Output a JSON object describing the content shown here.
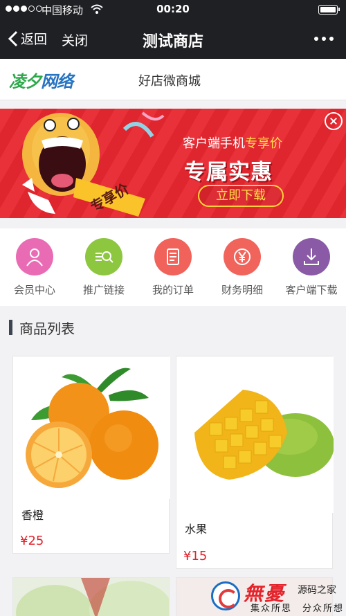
{
  "status_bar": {
    "carrier": "中国移动",
    "time": "00:20"
  },
  "nav": {
    "back_label": "返回",
    "close_label": "关闭",
    "title": "测试商店"
  },
  "brand": {
    "logo_part1": "凌夕",
    "logo_part2": "网络",
    "shop_title": "好店微商城"
  },
  "banner": {
    "mascot_tag": "专享价",
    "subtitle_prefix": "客户端手机",
    "subtitle_highlight": "专享价",
    "headline": "专属实惠",
    "download_label": "立即下载"
  },
  "shortcuts": [
    {
      "label": "会员中心",
      "icon": "user-icon",
      "color": "#e96bb4"
    },
    {
      "label": "推广链接",
      "icon": "promo-link-icon",
      "color": "#8dc63f"
    },
    {
      "label": "我的订单",
      "icon": "order-icon",
      "color": "#f0625a"
    },
    {
      "label": "财务明细",
      "icon": "yen-icon",
      "color": "#f0645c"
    },
    {
      "label": "客户端下载",
      "icon": "download-icon",
      "color": "#8a5aa6"
    }
  ],
  "section": {
    "title": "商品列表"
  },
  "products": [
    {
      "name": "香橙",
      "price": "¥25",
      "image": "orange-image"
    },
    {
      "name": "水果",
      "price": "¥15",
      "image": "mango-image"
    }
  ],
  "watermark": {
    "logo_text": "無憂",
    "tag": "源码之家",
    "sub": "集众所思　分众所想"
  },
  "colors": {
    "nav_bg": "#1f2024",
    "banner_bg": "#e8262f",
    "price": "#e2232c",
    "accent_yellow": "#ffe14a"
  }
}
